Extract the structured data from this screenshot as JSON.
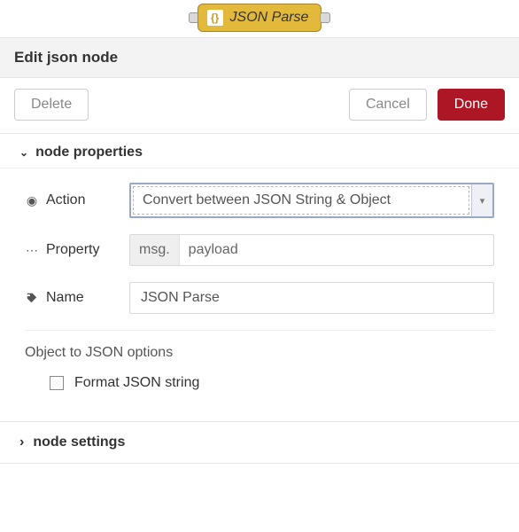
{
  "node": {
    "chip_label": "JSON Parse",
    "chip_icon": "{}"
  },
  "header": {
    "title": "Edit json node"
  },
  "buttons": {
    "delete": "Delete",
    "cancel": "Cancel",
    "done": "Done"
  },
  "sections": {
    "properties_title": "node properties",
    "settings_title": "node settings"
  },
  "form": {
    "action_label": "Action",
    "action_value": "Convert between JSON String & Object",
    "property_label": "Property",
    "property_prefix": "msg.",
    "property_value": "payload",
    "name_label": "Name",
    "name_value": "JSON Parse",
    "options_heading": "Object to JSON options",
    "format_label": "Format JSON string"
  }
}
